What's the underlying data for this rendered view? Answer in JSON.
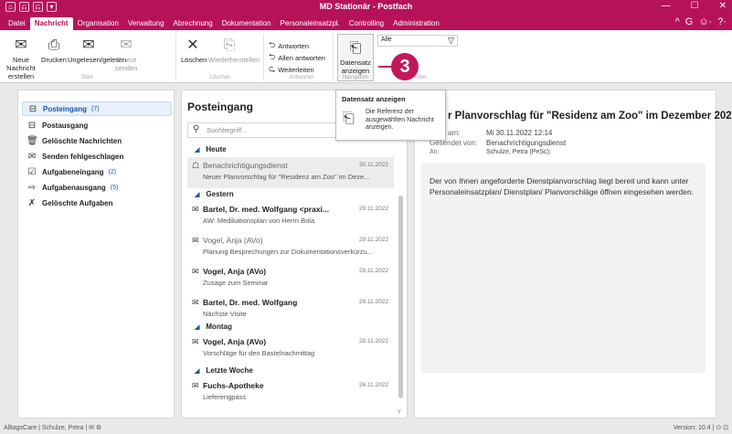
{
  "app": {
    "title": "MD Stationär - Postfach",
    "quick_access": [
      "⌂",
      "⎌",
      "⎌",
      "▾"
    ],
    "window_controls": [
      "—",
      "☐",
      "✕"
    ],
    "menu_right": [
      "^",
      "G",
      "☺·",
      "?·"
    ]
  },
  "menu": {
    "tabs": [
      "Datei",
      "Nachricht",
      "Organisation",
      "Verwaltung",
      "Abrechnung",
      "Dokumentation",
      "Personaleinsatzpl.",
      "Controlling",
      "Administration"
    ],
    "active_index": 1
  },
  "ribbon": {
    "new_message": "Neue Nachricht erstellen",
    "print": "Drucken",
    "unread_read": "Ungelesen/gelesen",
    "resend": "Erneut senden",
    "group_start": "Start",
    "delete": "Löschen",
    "restore": "Wiederherstellen",
    "group_delete": "Löschen",
    "reply": "Antworten",
    "reply_all": "Allen antworten",
    "forward": "Weiterleiten",
    "group_answer": "Antworten",
    "show_record": "Datensatz anzeigen",
    "group_navigation": "Navigation",
    "filter_value": "Alle",
    "group_filter": "Filter"
  },
  "badge": {
    "number": "3",
    "color": "#c2185b"
  },
  "tooltip": {
    "title": "Datensatz anzeigen",
    "text": "Die Referenz der ausgewählten Nachricht anzeigen."
  },
  "sidebar": {
    "items": [
      {
        "label": "Posteingang",
        "count": "(7)",
        "icon": "inbox-icon",
        "glyph": "⊟"
      },
      {
        "label": "Postausgang",
        "count": "",
        "icon": "outbox-icon",
        "glyph": "⊟"
      },
      {
        "label": "Gelöschte Nachrichten",
        "count": "",
        "icon": "trash-icon",
        "glyph": "🗑"
      },
      {
        "label": "Senden fehlgeschlagen",
        "count": "",
        "icon": "send-failed-icon",
        "glyph": "✉"
      },
      {
        "label": "Aufgabeneingang",
        "count": "(2)",
        "icon": "task-inbox-icon",
        "glyph": "☑"
      },
      {
        "label": "Aufgabenausgang",
        "count": "(5)",
        "icon": "task-outbox-icon",
        "glyph": "⇨"
      },
      {
        "label": "Gelöschte Aufgaben",
        "count": "",
        "icon": "deleted-tasks-icon",
        "glyph": "✗"
      }
    ]
  },
  "list": {
    "title": "Posteingang",
    "search_placeholder": "Suchbegriff...",
    "groups": [
      "Heute",
      "Gestern",
      "Montag",
      "Letzte Woche"
    ],
    "messages": [
      {
        "sender": "Benachrichtigungsdienst",
        "subject": "Neuer Planvorschlag für \"Residenz am Zoo\" im Deze...",
        "date": "30.11.2022",
        "icon": "☖"
      },
      {
        "sender": "Bartel, Dr. med. Wolfgang <praxi...",
        "subject": "AW: Medikationsplan von Herrn Bola",
        "date": "29.11.2022",
        "icon": "✉"
      },
      {
        "sender": "Vogel, Anja (AVo)",
        "subject": "Planung Besprechungen zur Dokumentationsverkürzu...",
        "date": "29.11.2022",
        "icon": "✉"
      },
      {
        "sender": "Vogel, Anja (AVo)",
        "subject": "Zusage zum Seminar",
        "date": "29.11.2022",
        "icon": "✉"
      },
      {
        "sender": "Bartel, Dr. med. Wolfgang",
        "subject": "Nächste Visite",
        "date": "29.11.2022",
        "icon": "✉"
      },
      {
        "sender": "Vogel, Anja (AVo)",
        "subject": "Vorschläge für den Bastelnachmittag",
        "date": "28.11.2022",
        "icon": "✉"
      },
      {
        "sender": "Fuchs-Apotheke",
        "subject": "Lieferengpass",
        "date": "26.11.2022",
        "icon": "✉"
      }
    ]
  },
  "detail": {
    "title": "r Planvorschlag für \"Residenz am Zoo\" im Dezember 2022",
    "sent_label": "...det am:",
    "sent_value": "Mi 30.11.2022 12:14",
    "from_label": "Gesendet von:",
    "from_value": "Benachrichtigungsdienst",
    "to_label": "An:",
    "to_value": "Schulze, Petra (PeSc);",
    "body": "Der von Ihnen angeforderte Dienstplanvorschlag liegt bereit und kann unter Personaleinsatzplan/ Dienstplan/ Planvorschläge öffnen eingesehen werden."
  },
  "status": {
    "left": "AlltagsCare | Schulze, Petra | ✉ ⚙",
    "right": "Version: 10.4 | ⊙ ⊡"
  }
}
